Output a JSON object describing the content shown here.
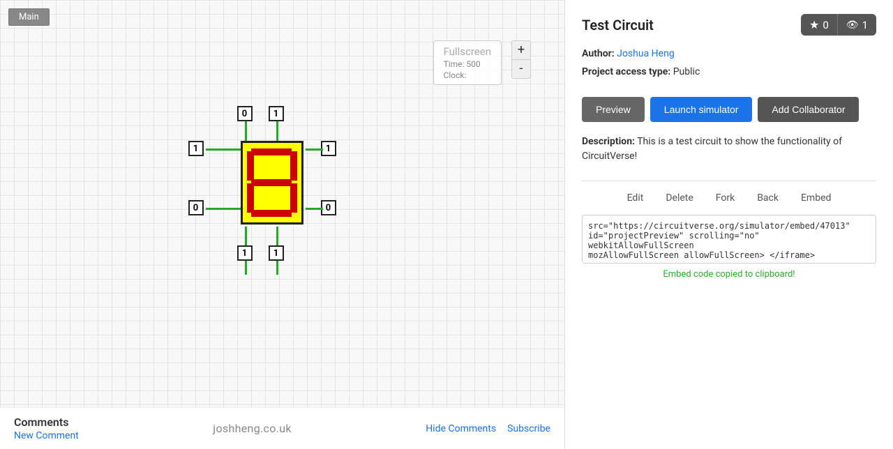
{
  "app": {
    "main_tab": "Main"
  },
  "canvas": {
    "fullscreen_label": "Fullscreen",
    "time_label": "Time: 500",
    "clock_label": "Clock:",
    "zoom_plus": "+",
    "zoom_minus": "-"
  },
  "project": {
    "title": "Test Circuit",
    "stars_count": "0",
    "views_count": "1",
    "author_label": "Author:",
    "author_name": "Joshua Heng",
    "access_label": "Project access type:",
    "access_value": "Public",
    "description_label": "Description:",
    "description_text": "This is a test circuit to show the functionality of CircuitVerse!",
    "buttons": {
      "preview": "Preview",
      "launch": "Launch simulator",
      "add_collaborator": "Add Collaborator"
    },
    "links": {
      "edit": "Edit",
      "delete": "Delete",
      "fork": "Fork",
      "back": "Back",
      "embed": "Embed"
    },
    "embed_code": "src=\"https://circuitverse.org/simulator/embed/47013\"\nid=\"projectPreview\" scrolling=\"no\" webkitAllowFullScreen\nmozAllowFullScreen allowFullScreen> </iframe>",
    "embed_copied": "Embed code copied to clipboard!"
  },
  "comments": {
    "title": "Comments",
    "new_comment": "New Comment",
    "hide_link": "Hide Comments",
    "subscribe_link": "Subscribe"
  },
  "footer": {
    "site_name": "joshheng.co.uk"
  }
}
